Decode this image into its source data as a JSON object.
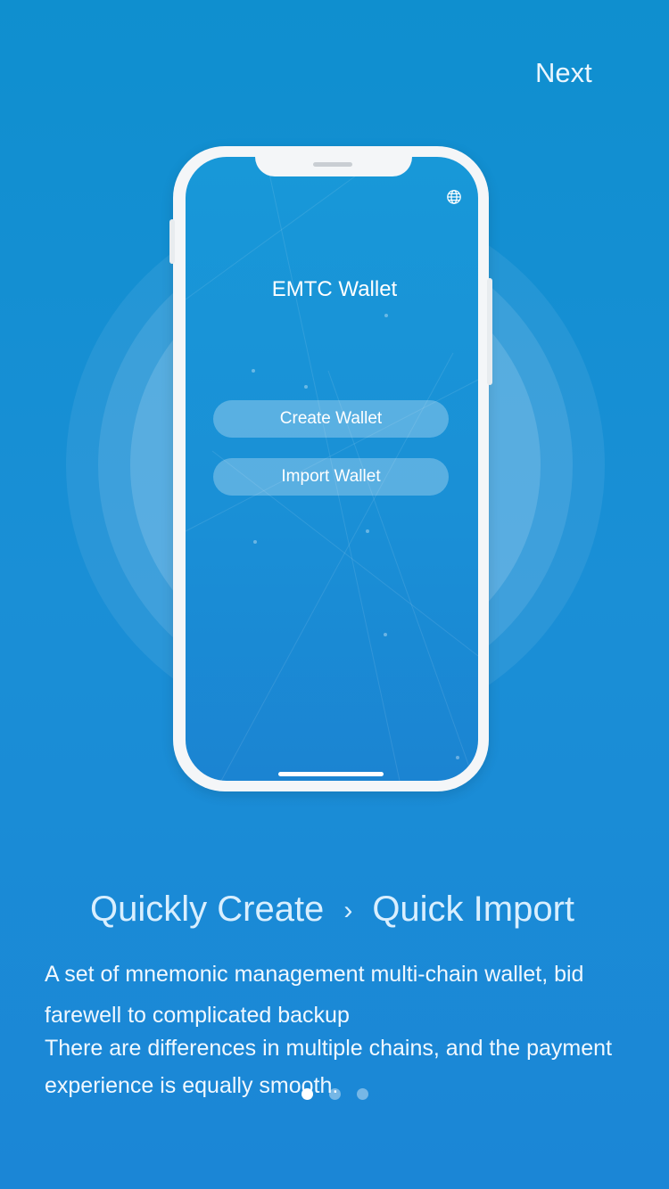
{
  "top_bar": {
    "next_label": "Next"
  },
  "phone_mock": {
    "app_title": "EMTC Wallet",
    "create_label": "Create Wallet",
    "import_label": "Import Wallet"
  },
  "caption": {
    "headline_left": "Quickly Create",
    "headline_sep": "›",
    "headline_right": "Quick Import",
    "line1": "A set of mnemonic management multi-chain wallet, bid farewell to complicated backup",
    "line2": "There are differences in multiple chains, and the payment experience is equally smooth."
  },
  "pagination": {
    "total_pages": 3,
    "current_page": 1
  },
  "colors": {
    "background": "#1a8fd6",
    "phone_body": "#f4f6f8",
    "text": "#ffffff"
  },
  "icons": [
    "globe-icon"
  ]
}
